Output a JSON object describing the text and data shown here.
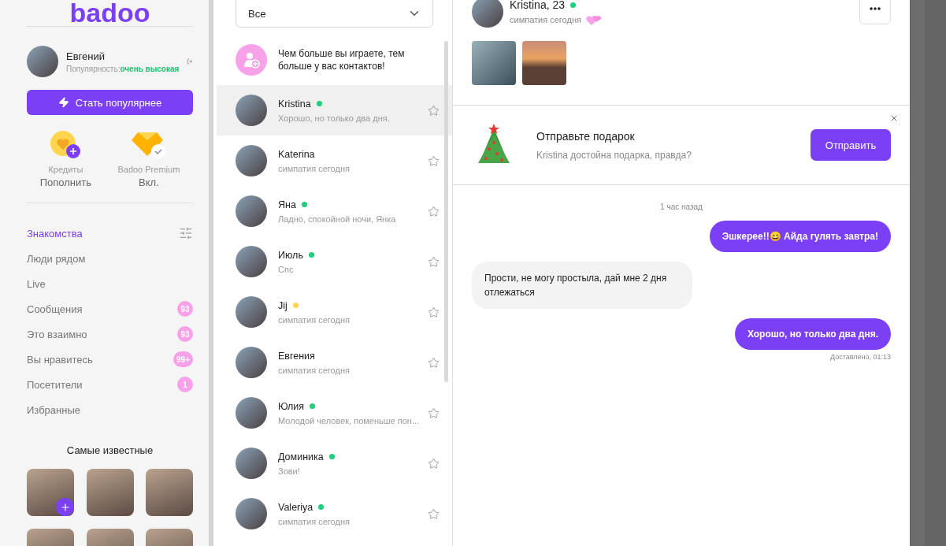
{
  "logo": "badoo",
  "profile": {
    "name": "Евгений",
    "popularity_label": "Популярность:",
    "popularity_value": "очень высокая"
  },
  "boost_button": "Стать популярнее",
  "wallet": [
    {
      "kind": "credits",
      "label": "Кредиты",
      "action": "Пополнить"
    },
    {
      "kind": "premium",
      "label": "Badoo Premium",
      "action": "Вкл."
    }
  ],
  "nav": [
    {
      "label": "Знакомства",
      "selected": true
    },
    {
      "label": "Люди рядом",
      "selected": false
    },
    {
      "label": "Live",
      "selected": false
    },
    {
      "label": "Сообщения",
      "selected": false,
      "badge": "93"
    },
    {
      "label": "Это взаимно",
      "selected": false,
      "badge": "93"
    },
    {
      "label": "Вы нравитесь",
      "selected": false,
      "badge": "99+"
    },
    {
      "label": "Посетители",
      "selected": false,
      "badge": "1"
    },
    {
      "label": "Избранные",
      "selected": false
    }
  ],
  "popular": {
    "title": "Самые известные"
  },
  "filter": {
    "value": "Все"
  },
  "promo": "Чем больше вы играете, тем больше у вас контактов!",
  "contacts": [
    {
      "name": "Kristina",
      "preview": "Хорошо, но только два дня.",
      "selected": true,
      "color": "#1fcf7c"
    },
    {
      "name": "Katerina",
      "preview": "симпатия сегодня",
      "selected": false
    },
    {
      "name": "Яна",
      "preview": "Ладно, спокойной ночи, Янка",
      "selected": false,
      "color": "#1fcf7c"
    },
    {
      "name": "Июль",
      "preview": "Спс",
      "selected": false,
      "color": "#1fcf7c"
    },
    {
      "name": "Jij",
      "preview": "симпатия сегодня",
      "selected": false,
      "color": "#ffd54f"
    },
    {
      "name": "Евгения",
      "preview": "симпатия сегодня",
      "selected": false
    },
    {
      "name": "Юлия",
      "preview": "Молодой человек, поменьше пон...",
      "selected": false,
      "color": "#1fcf7c"
    },
    {
      "name": "Доминика",
      "preview": "Зови!",
      "selected": false,
      "color": "#1fcf7c"
    },
    {
      "name": "Valeriya",
      "preview": "симпатия сегодня",
      "selected": false,
      "color": "#1fcf7c"
    }
  ],
  "chat": {
    "name": "Kristina, 23",
    "online": true,
    "subtitle": "симпатия сегодня",
    "gift": {
      "title": "Отправьте подарок",
      "text": "Kristina достойна подарка, правда?",
      "button": "Отправить"
    },
    "messages": [
      {
        "kind": "time",
        "text": "1 час назад"
      },
      {
        "kind": "outgoing",
        "text": "Эшкерее!!😄 Айда гулять завтра!"
      },
      {
        "kind": "incoming",
        "text": "Прости, не могу простыла, дай мне 2 дня отлежаться"
      },
      {
        "kind": "outgoing",
        "text": "Хорошо, но только два дня."
      },
      {
        "kind": "status",
        "text": "Доставлено, 01:13"
      }
    ]
  }
}
